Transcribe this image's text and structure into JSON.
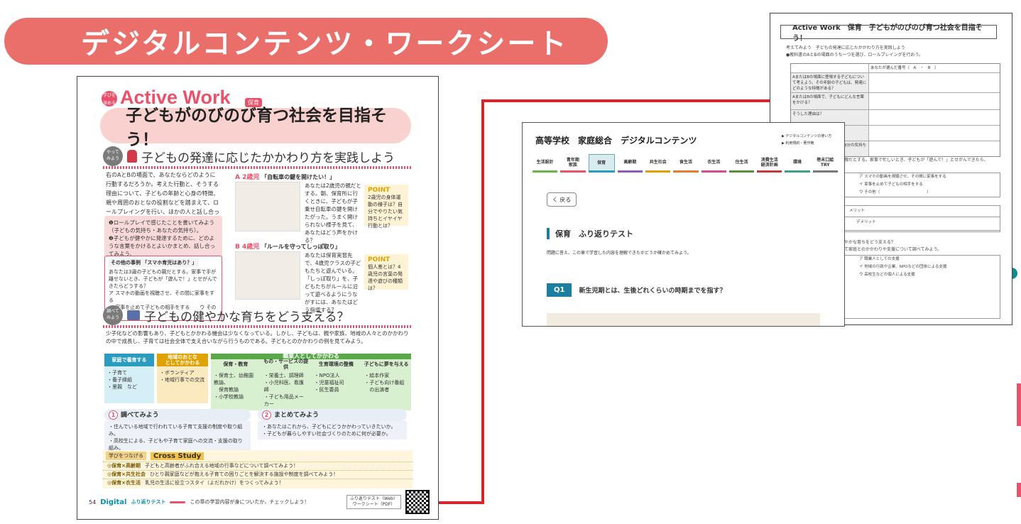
{
  "banner": {
    "title": "デジタルコンテンツ・ワークシート"
  },
  "textbook": {
    "badge": "学びを\n深める",
    "title": "Active Work",
    "tag": "保育",
    "headline": "子どもがのびのび育つ社会を目指そう！",
    "section1": {
      "badge": "やって\nみよう",
      "title": "子どもの発達に応じたかかわり方を実践しよう"
    },
    "intro": "右のAとBの場面で、あなたならどのように行動するだろうか。考えた行動と、そうする理由について、子どもの年齢と心身の特徴、親や周囲のおとなの役割などを踏まえて、ロールプレイングを行い、ほかの人と話し合ってみよう。",
    "questions": "❶ロールプレイで感じたことを書いてみよう（子どもの気持ち・あなたの気持ち）。\n❷子どもが健やかに発達するために、どのような言葉をかけるとよいかまとめ、話し合ってみよう。",
    "other": {
      "title": "その他の事例 「スマホ育児はあり？」",
      "text": "あなたは3歳の子どもの親だとする。家事で手が離せないとき、子どもが「遊んで！」とせがんできたらどうする？",
      "options": "ア スマホの動画を視聴させ、その間に家事をする\nイ 家事を止めて子どもの相手をする　　ウ その他"
    },
    "caseA": {
      "label": "A 2歳児",
      "title": "「自転車の鍵を開けたい！」",
      "text": "あなたは2歳児の親だとする。朝、保育所に行くときに、子どもが子乗せ自転車の鍵を開けたがった。うまく開けられない様子を見て、あなたはどう声をかける？"
    },
    "pointA": {
      "label": "POINT",
      "text": "2歳児の身体運動の様子は？自分でやりたい気持ちとイヤイヤ行動とは？"
    },
    "caseB": {
      "label": "B 4歳児",
      "title": "「ルールを守ってしっぽ取り」",
      "text": "あなたは保育実習先で、4歳児クラスの子どもたちと遊んでいる。「しっぽ取り」を、子どもたちがルールに沿って遊べるようにうながすには、あなたはどう指導する？"
    },
    "pointB": {
      "label": "POINT",
      "text": "個人差とは？4歳児の言葉の発達や遊びの種類は？"
    },
    "section2": {
      "badge": "調べて\nみよう",
      "title": "子どもの健やかな育ちをどう支える？"
    },
    "intro2": "少子化などの影響もあり、子どもとかかわる機会は少なくなっている。しかし、子どもは、親や家族、地域の人々とのかかわりの中で成長し、子育ては社会全体で支え合いながら行うものである。子どもとのかかわりの例を見てみよう。",
    "grid": [
      {
        "head": "家庭で養育する",
        "body": "・子育て\n・養子縁組\n・里親　など"
      },
      {
        "head": "地域のおとな\nとしてかかわる",
        "body": "・ボランティア\n・地域行事での交流"
      },
      {
        "head": "保育・教育",
        "body": "・保育士、幼稚園教諭、\n　保育教諭\n・小学校教諭"
      },
      {
        "head": "もの・サービスの提供",
        "body": "・栄養士、調理師\n・小児科医、看護師\n・子ども用品メーカー"
      },
      {
        "head": "生育環境の整備",
        "body": "・NPO法人\n・児童福祉司\n・民生委員"
      },
      {
        "head": "子どもに夢を与える",
        "body": "・絵本作家\n・子ども向け番組\n　の出演者"
      }
    ],
    "grid_group": "職業人としてかかわる",
    "step1": {
      "num": "1",
      "title": "調べてみよう",
      "text": "・住んでいる地域で行われている子育て支援の制度や取り組み。\n・高校生による、子どもや子育て家庭への交流・支援の取り組み。"
    },
    "step2": {
      "num": "2",
      "title": "まとめてみよう",
      "text": "・あなたはこれから、子どもにどうかかわっていきたいか。\n・子どもが暮らしやすい社会づくりのために何が必要か。"
    },
    "cross": {
      "label": "学びをつなげる",
      "title": "Cross Study",
      "rows": [
        {
          "k": "◎保育×高齢期",
          "v": "子どもと高齢者がふれ合える地域の行事などについて調べてみよう！"
        },
        {
          "k": "◎保育×共生社会",
          "v": "ひとり親家庭などが抱える子育ての困りごとを解決する施設や制度を調べてみよう！"
        },
        {
          "k": "◎保育×衣生活",
          "v": "乳児の生活に役立つスタイ（よだれかけ）をつくってみよう！"
        }
      ]
    },
    "footer": {
      "page": "54",
      "digital": "Digital",
      "digital_sub": "ふり返りテスト",
      "text": "この章の学習内容が身についたか、チェックしよう！",
      "box": "ふり返りテスト（Web）\nワークシート（PDF）"
    }
  },
  "digital": {
    "title": "高等学校　家庭総合　デジタルコンテンツ",
    "links": [
      "▶ デジタルコンテンツの使い方",
      "▶ 利用規約・著作権"
    ],
    "tabs": [
      {
        "label": "生活設計",
        "color": "#6bb34a"
      },
      {
        "label": "青年期\n家族",
        "color": "#e8526b"
      },
      {
        "label": "保育",
        "color": "#2a9cc0",
        "active": true
      },
      {
        "label": "高齢期",
        "color": "#8a5bbf"
      },
      {
        "label": "共生社会",
        "color": "#e0a200"
      },
      {
        "label": "食生活",
        "color": "#e67c2c"
      },
      {
        "label": "衣生活",
        "color": "#d14b8f"
      },
      {
        "label": "住生活",
        "color": "#5a8f3a"
      },
      {
        "label": "消費生活\n経済計画",
        "color": "#c23b3b"
      },
      {
        "label": "環境",
        "color": "#3aa08a"
      },
      {
        "label": "巻末口絵\nTRY",
        "color": "#777777"
      }
    ],
    "back": "く 戻る",
    "heading": "保育　ふり返りテスト",
    "instruction": "問題に答え、この章で学習した内容を理解できたかどうか確かめてみよう。",
    "q_num": "Q1",
    "q_text": "新生児期とは、生後どれくらいの時期までを指す？"
  },
  "worksheet": {
    "title": "Active Work　保育　子どもがのびのび育つ社会を目指そう！",
    "line1": "考えてみよう　子どもの発達に応じたかかわり方を実践しよう",
    "line2": "●教科書のAとBの場面のうち一つを選び、ロールプレイングを行おう。",
    "choice": "あなたが選んだ番号（　A　・　B　）",
    "rows": [
      "AまたはBの場面に登場する子どもについて考えよう。その年齢の子どもは、発達にどのような特徴がある？",
      "AまたはBの場面で、子どもにどんな言葉をかける？",
      "そうした理由は？",
      "",
      "ロールプレイングを通して、自分の気持ちを記入しよう。"
    ],
    "side_text": "親だとする。家事で忙しいとき、子どもが「遊んで！」とせがんできたら、",
    "opts": [
      "ア スマホの動画を視聴させ、その間に家事をする",
      "イ 家事を止めて子どもの相手をする",
      "ウ その他（　　　　　　　　　　　　）"
    ],
    "merit": "メリット",
    "demerit": "デメリット",
    "q2": "やかな育ちをどう支える？",
    "q2b": "て家庭とのかかわりや支援について調べてみよう。",
    "opts2": [
      "ア 職業人としての支援",
      "イ 地域の行政や企業、NPOなどの団体による支援",
      "ウ 高校生などの個人による支援"
    ]
  }
}
